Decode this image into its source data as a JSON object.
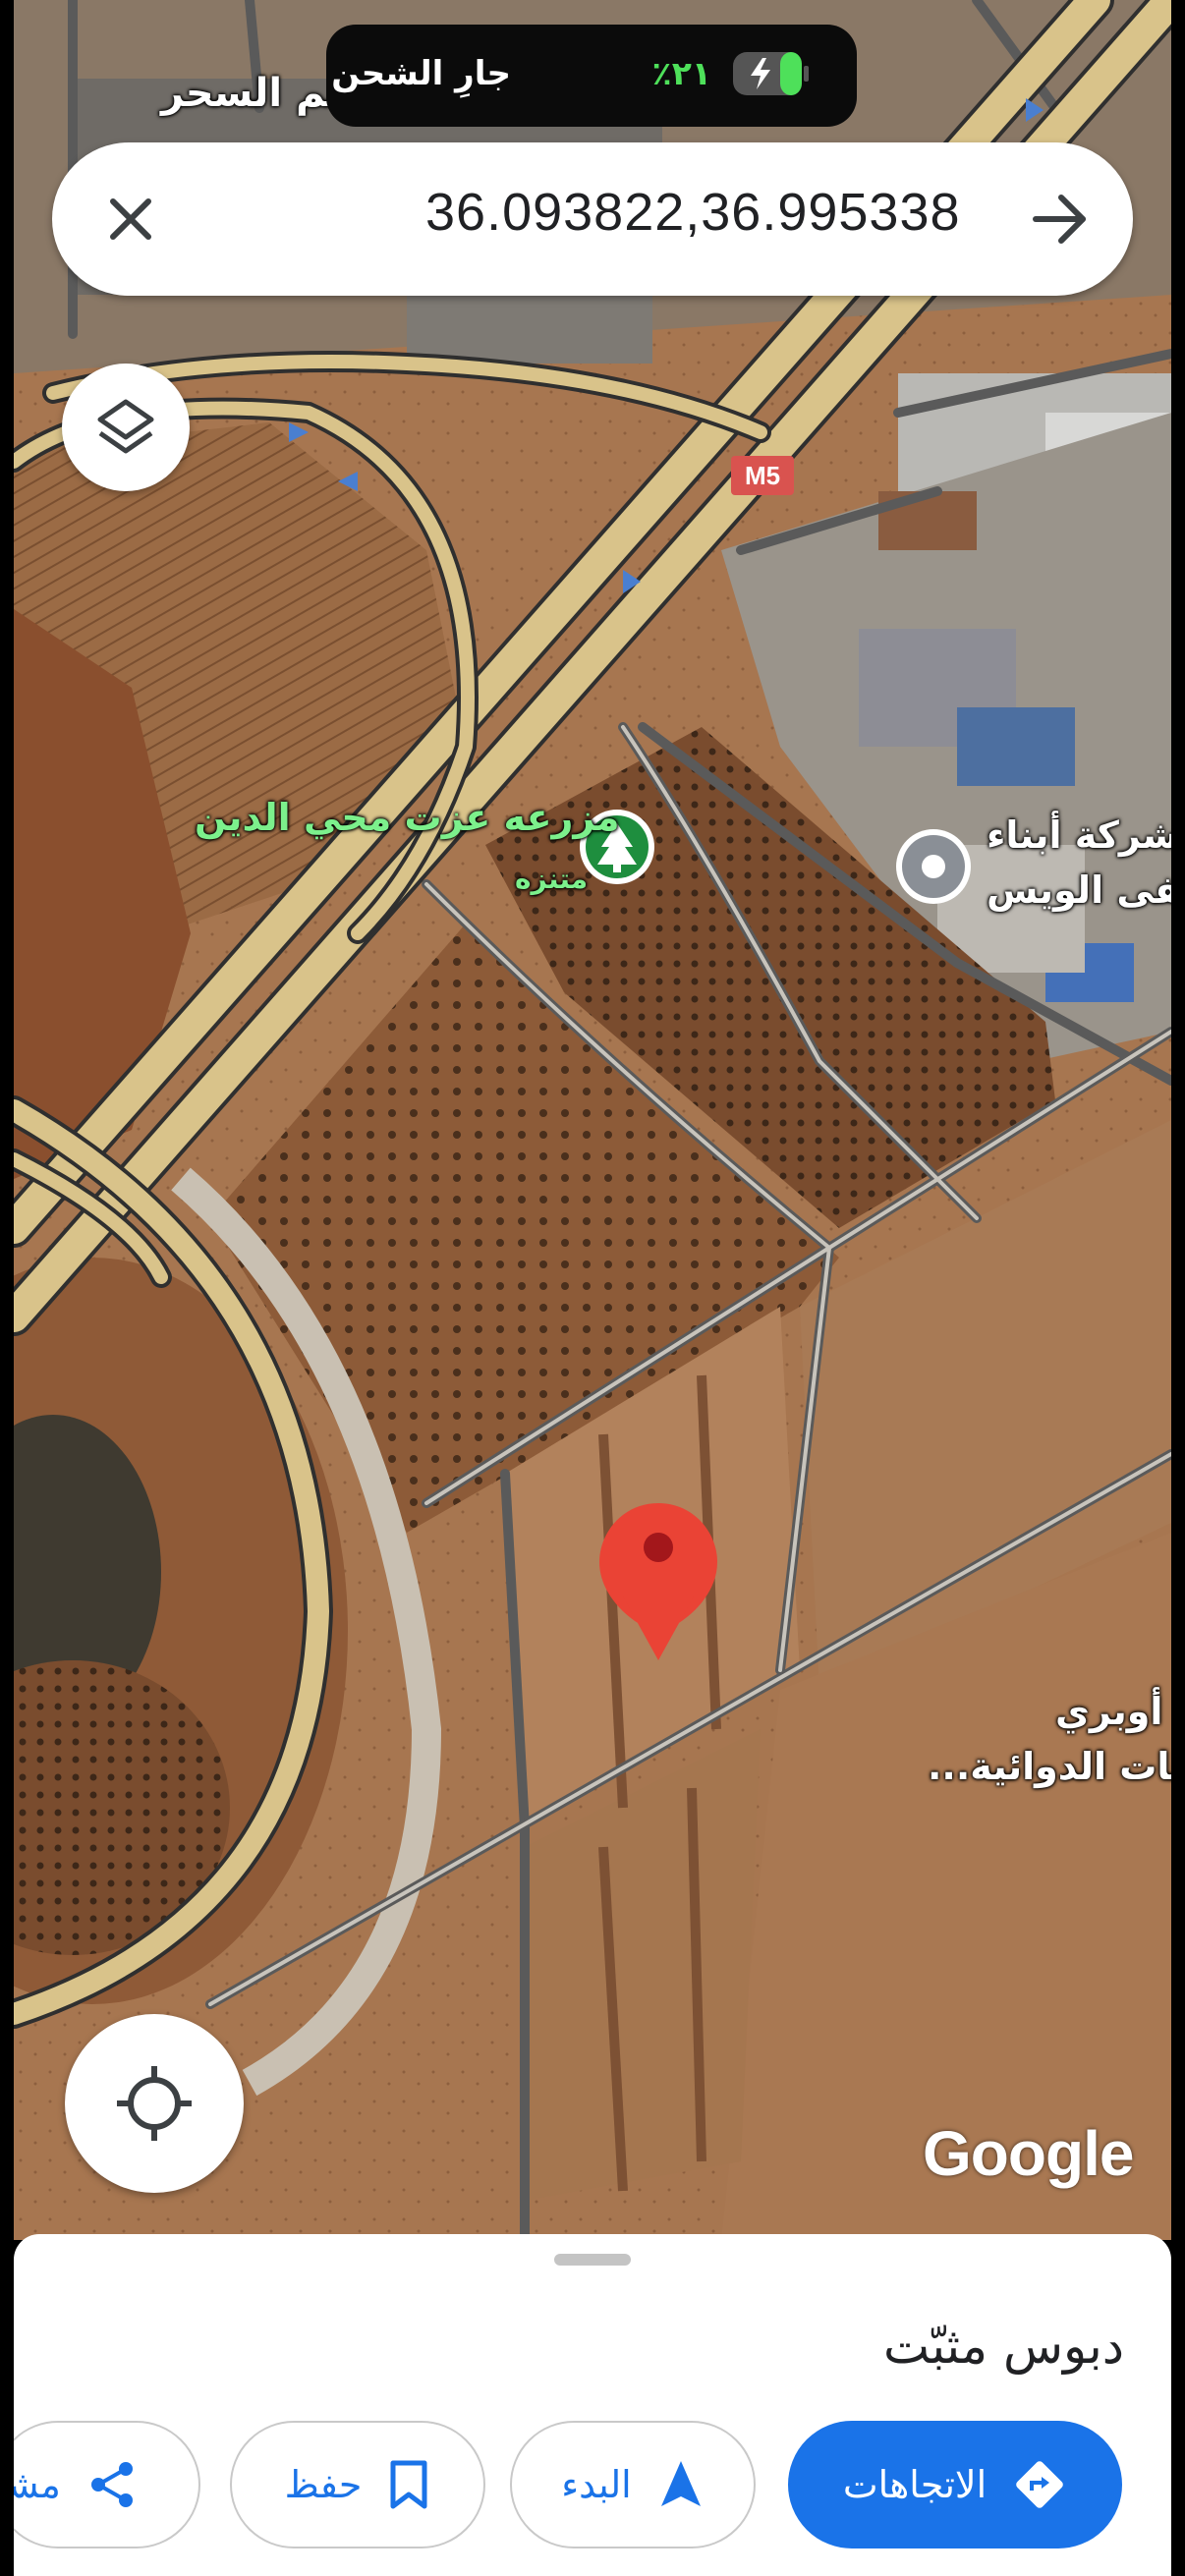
{
  "status_bar": {
    "charging_text": "جارِ الشحن",
    "battery_percent": "٢١٪"
  },
  "search": {
    "query": "36.093822,36.995338"
  },
  "map": {
    "labels": {
      "top_label": "عالم السحر",
      "farm_name": "مزرعه عزت محي الدين",
      "farm_category": "متنزه",
      "company_line1": "شركة أبناء",
      "company_line2": "طفى الويس",
      "pharma_line1": "أوبري",
      "pharma_line2": "عات الدوائية...",
      "road_shield": "M5",
      "attribution": "Google"
    },
    "colors": {
      "road": "#d9c38a",
      "road_outline": "#3b3b3b",
      "pin": "#ea4335",
      "park_marker": "#1e8e3e",
      "poi_marker": "#8a8f96"
    }
  },
  "place": {
    "title": "دبوس مثبّت"
  },
  "actions": {
    "directions": "الاتجاهات",
    "start": "البدء",
    "save": "حفظ",
    "share": "مشا"
  },
  "icons": {
    "close": "close-icon",
    "go": "arrow-right-icon",
    "layers": "layers-icon",
    "location": "my-location-icon",
    "directions": "directions-icon",
    "start": "navigation-icon",
    "save": "bookmark-icon",
    "share": "share-icon"
  }
}
